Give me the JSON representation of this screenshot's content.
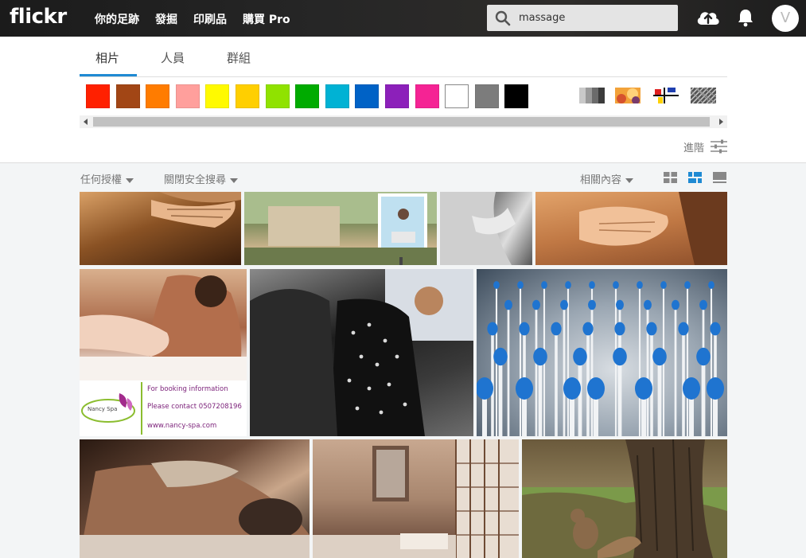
{
  "header": {
    "logo": "flickr",
    "nav": [
      "你的足跡",
      "發掘",
      "印刷品",
      "購買 Pro"
    ],
    "search_value": "massage",
    "avatar_letter": "V"
  },
  "tabs": [
    "相片",
    "人員",
    "群組"
  ],
  "color_swatches": [
    {
      "name": "red",
      "color": "#ff2000"
    },
    {
      "name": "brown",
      "color": "#a24615"
    },
    {
      "name": "orange",
      "color": "#ff7c00"
    },
    {
      "name": "pink",
      "color": "#ff9f9c"
    },
    {
      "name": "yellow",
      "color": "#fffa00"
    },
    {
      "name": "gold",
      "color": "#ffcf00"
    },
    {
      "name": "lime",
      "color": "#90e200"
    },
    {
      "name": "green",
      "color": "#00ab00"
    },
    {
      "name": "teal",
      "color": "#00b2d4"
    },
    {
      "name": "blue",
      "color": "#0062c6"
    },
    {
      "name": "purple",
      "color": "#8c20ba"
    },
    {
      "name": "magenta",
      "color": "#f52394"
    },
    {
      "name": "white",
      "color": "#ffffff"
    },
    {
      "name": "gray",
      "color": "#7c7c7c"
    },
    {
      "name": "black",
      "color": "#000000"
    }
  ],
  "style_filters": [
    "black-and-white-icon",
    "shallow-depth-icon",
    "minimalist-icon",
    "pattern-icon"
  ],
  "advanced_label": "進階",
  "filters": {
    "license": "任何授權",
    "safesearch": "關閉安全搜尋",
    "sort": "相關內容"
  },
  "photos": [
    {
      "name": "photo-hands-back",
      "bg": "linear-gradient(160deg,#d9a066 0%,#8a5224 45%,#3a1e0c 100%)"
    },
    {
      "name": "photo-street-sign",
      "bg": "linear-gradient(180deg,#9fb27e 0%,#7a8a5a 40%,#c7b28a 75%,#5e6a3e 100%)"
    },
    {
      "name": "photo-bw-neck",
      "bg": "linear-gradient(120deg,#222 0%,#888 45%,#ddd 70%,#555 100%)"
    },
    {
      "name": "photo-shoulder-massage",
      "bg": "linear-gradient(170deg,#e2a36a 0%,#c07844 50%,#8c4e2a 100%)"
    },
    {
      "name": "photo-nancy-spa",
      "bg": "linear-gradient(180deg,#d9b08d 0%,#a86646 35%,#f2e7df 60%,#ffffff 100%)"
    },
    {
      "name": "photo-group-hug",
      "bg": "linear-gradient(160deg,#8a8a8a 0%,#1d1d1d 40%,#3a3a3a 70%,#6d6d6d 100%)"
    },
    {
      "name": "photo-blue-pins",
      "bg": "radial-gradient(ellipse at 55% 60%,#d8dde2 0%,#9aa6b2 45%,#3d4c5c 100%)"
    },
    {
      "name": "photo-lying-man",
      "bg": "linear-gradient(150deg,#2a1a12 0%,#6b4a38 40%,#c9a68a 65%,#2a1d16 100%)"
    },
    {
      "name": "photo-spa-room",
      "bg": "linear-gradient(180deg,#c8a890 0%,#a8866e 50%,#5e3e30 100%)"
    },
    {
      "name": "photo-squirrel",
      "bg": "linear-gradient(180deg,#6b5a3c 0%,#8a7a56 40%,#4e5a2e 70%,#7a6a4a 100%)"
    }
  ],
  "spa_card": {
    "brand": "Nancy Spa",
    "line1": "For booking information",
    "line2": "Please contact 0507208196",
    "line3": "www.nancy-spa.com"
  }
}
